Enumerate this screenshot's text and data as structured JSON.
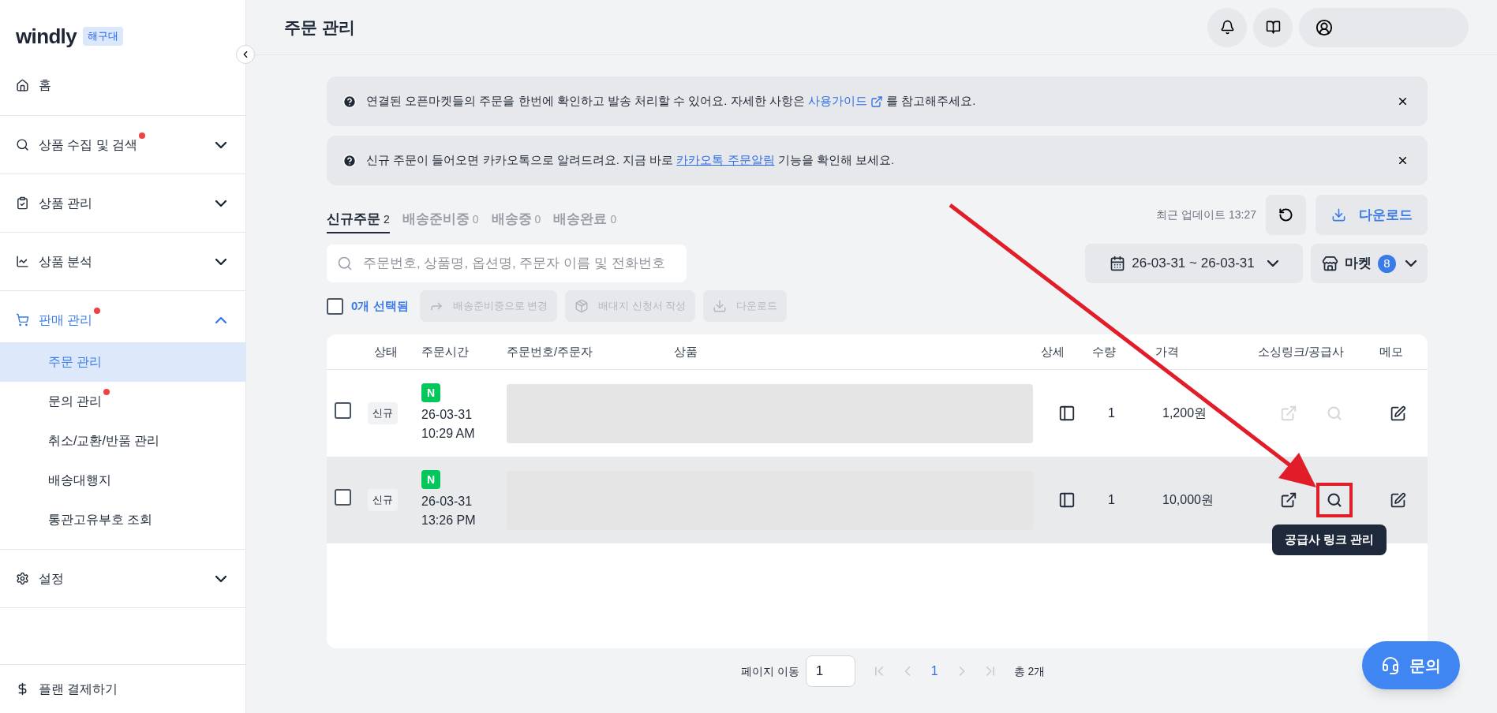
{
  "sidebar": {
    "logo": "windly",
    "badge": "해구대",
    "items": [
      {
        "label": "홈",
        "dot": false
      },
      {
        "label": "상품 수집 및 검색",
        "dot": true,
        "expanded": false
      },
      {
        "label": "상품 관리",
        "dot": false,
        "expanded": false
      },
      {
        "label": "상품 분석",
        "dot": false,
        "expanded": false
      },
      {
        "label": "판매 관리",
        "dot": true,
        "expanded": true,
        "children": [
          {
            "label": "주문 관리",
            "selected": true,
            "dot": false
          },
          {
            "label": "문의 관리",
            "selected": false,
            "dot": true
          },
          {
            "label": "취소/교환/반품 관리",
            "selected": false,
            "dot": false
          },
          {
            "label": "배송대행지",
            "selected": false,
            "dot": false
          },
          {
            "label": "통관고유부호 조회",
            "selected": false,
            "dot": false
          }
        ]
      },
      {
        "label": "설정",
        "dot": false,
        "expanded": false
      }
    ],
    "footer": "플랜 결제하기"
  },
  "header": {
    "title": "주문 관리"
  },
  "notices": [
    {
      "kind": "external",
      "before": "연결된 오픈마켓들의 주문을 한번에 확인하고 발송 처리할 수 있어요. 자세한 사항은 ",
      "link": "사용가이드",
      "after": " 를 참고해주세요."
    },
    {
      "kind": "underline",
      "before": "신규 주문이 들어오면 카카오톡으로 알려드려요. 지금 바로 ",
      "link": "카카오톡 주문알림",
      "after": " 기능을 확인해 보세요."
    }
  ],
  "tabs": [
    {
      "label": "신규주문",
      "count": "2",
      "selected": true
    },
    {
      "label": "배송준비중",
      "count": "0",
      "selected": false
    },
    {
      "label": "배송중",
      "count": "0",
      "selected": false
    },
    {
      "label": "배송완료",
      "count": "0",
      "selected": false
    }
  ],
  "update": "최근 업데이트 13:27",
  "download": "다운로드",
  "search": {
    "placeholder": "주문번호, 상품명, 옵션명, 주문자 이름 및 전화번호"
  },
  "date_range": "26-03-31 ~ 26-03-31",
  "market": {
    "label": "마켓",
    "count": "8"
  },
  "selection": {
    "checked": false,
    "label": "0개 선택됨"
  },
  "actions": [
    {
      "label": "배송준비중으로 변경",
      "disabled": true
    },
    {
      "label": "배대지 신청서 작성",
      "disabled": true
    },
    {
      "label": "다운로드",
      "disabled": true
    }
  ],
  "table": {
    "columns": [
      "상태",
      "주문시간",
      "주문번호/주문자",
      "상품",
      "상세",
      "수량",
      "가격",
      "소싱링크/공급사",
      "메모"
    ],
    "rows": [
      {
        "checked": false,
        "status": "신규",
        "market": "N",
        "date": "26-03-31",
        "time": "10:29 AM",
        "quantity": "1",
        "price": "1,200원",
        "link_enabled": false,
        "hovered": false
      },
      {
        "checked": false,
        "status": "신규",
        "market": "N",
        "date": "26-03-31",
        "time": "13:26 PM",
        "quantity": "1",
        "price": "10,000원",
        "link_enabled": true,
        "hovered": true,
        "tooltip": "공급사 링크 관리"
      }
    ]
  },
  "pagination": {
    "label": "페이지 이동",
    "value": "1",
    "pages": [
      {
        "label": "1",
        "selected": true
      }
    ],
    "total": "총 2개"
  },
  "help_button": "문의"
}
